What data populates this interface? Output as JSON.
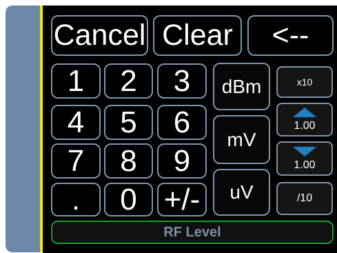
{
  "keypad": {
    "top_row": {
      "cancel": "Cancel",
      "clear": "Clear",
      "backspace": "<--"
    },
    "digits": [
      "1",
      "2",
      "3",
      "4",
      "5",
      "6",
      "7",
      "8",
      "9",
      ".",
      "0",
      "+/-"
    ],
    "units": [
      "dBm",
      "mV",
      "uV"
    ],
    "step": {
      "multiply": "x10",
      "increment_value": "1.00",
      "decrement_value": "1.00",
      "divide": "/10",
      "increment_icon": "up-triangle-icon",
      "decrement_icon": "down-triangle-icon"
    },
    "field_label": "RF Level"
  },
  "colors": {
    "sidebar": "#6e88a8",
    "sidebar_edge": "#f2e600",
    "key_border": "#7f95ad",
    "arrow": "#1e7fc1",
    "status_border": "#199f2d",
    "status_text": "#7c8ea2"
  }
}
